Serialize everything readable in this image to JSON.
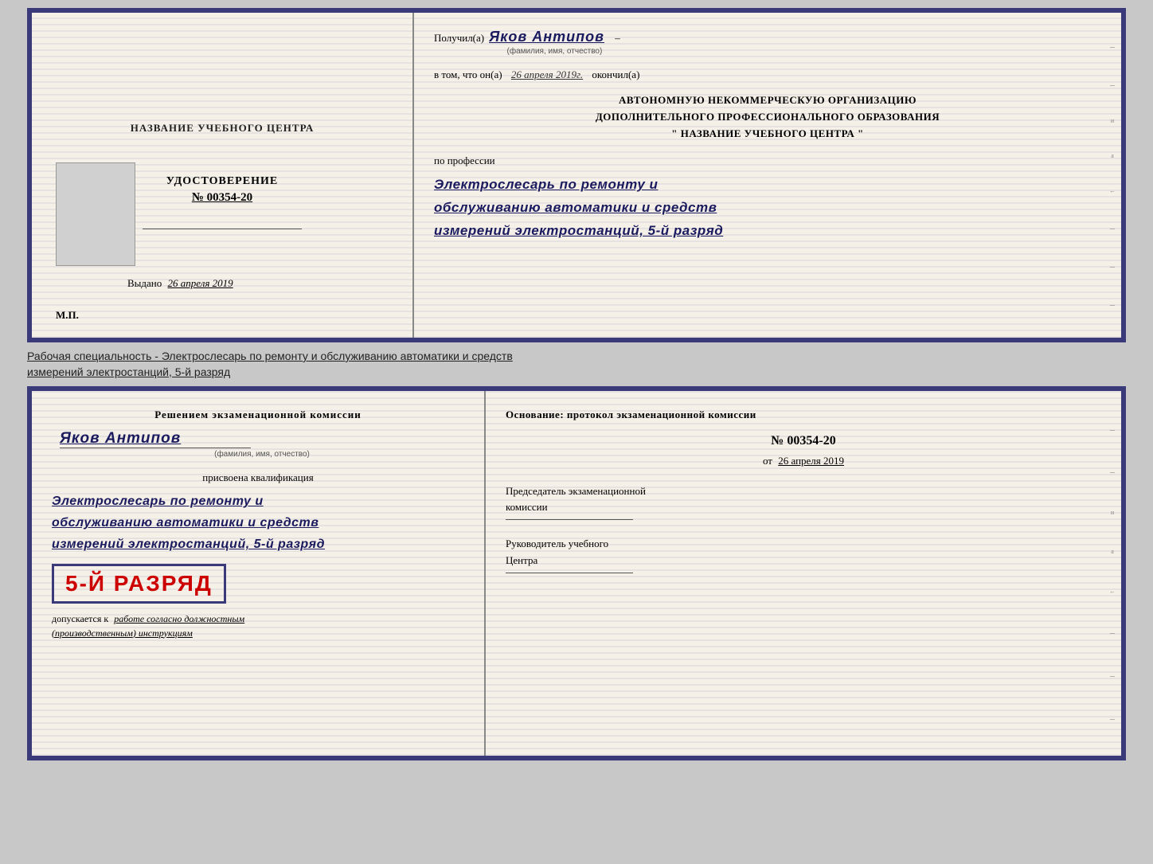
{
  "top_diploma": {
    "left": {
      "title": "НАЗВАНИЕ УЧЕБНОГО ЦЕНТРА",
      "photo_alt": "фото",
      "udostoverenie_label": "УДОСТОВЕРЕНИЕ",
      "number": "№ 00354-20",
      "vydano_prefix": "Выдано",
      "vydano_date": "26 апреля 2019",
      "mp_label": "М.П."
    },
    "right": {
      "poluchil_prefix": "Получил(а)",
      "recipient_name": "Яков Антипов",
      "fio_label": "(фамилия, имя, отчество)",
      "vtom_prefix": "в том, что он(а)",
      "vtom_date": "26 апреля 2019г.",
      "okончил": "окончил(а)",
      "org_line1": "АВТОНОМНУЮ НЕКОММЕРЧЕСКУЮ ОРГАНИЗАЦИЮ",
      "org_line2": "ДОПОЛНИТЕЛЬНОГО ПРОФЕССИОНАЛЬНОГО ОБРАЗОВАНИЯ",
      "org_name": "\"  НАЗВАНИЕ УЧЕБНОГО ЦЕНТРА  \"",
      "po_professii": "по профессии",
      "profession_line1": "Электрослесарь по ремонту и",
      "profession_line2": "обслуживанию автоматики и средств",
      "profession_line3": "измерений электростанций, 5-й разряд"
    }
  },
  "specialty_text": "Рабочая специальность - Электрослесарь по ремонту и обслуживанию автоматики и средств\nизмерений электростанций, 5-й разряд",
  "bottom_diploma": {
    "left": {
      "resheniem_prefix": "Решением экзаменационной комиссии",
      "person_name": "Яков Антипов",
      "fio_label": "(фамилия, имя, отчество)",
      "prisvоena": "присвоена квалификация",
      "qual_line1": "Электрослесарь по ремонту и",
      "qual_line2": "обслуживанию автоматики и средств",
      "qual_line3": "измерений электростанций, 5-й разряд",
      "razryad_badge": "5-й разряд",
      "dopuskaetsya_prefix": "допускается к",
      "dopuskaetsya_text": "работе согласно должностным",
      "dopuskaetsya_text2": "(производственным) инструкциям"
    },
    "right": {
      "osnovanie": "Основание: протокол экзаменационной  комиссии",
      "protocol_number": "№  00354-20",
      "ot_prefix": "от",
      "ot_date": "26 апреля 2019",
      "predsedatel": "Председатель экзаменационной\nкомиссии",
      "rukovoditel": "Руководитель учебного\nЦентра"
    }
  }
}
